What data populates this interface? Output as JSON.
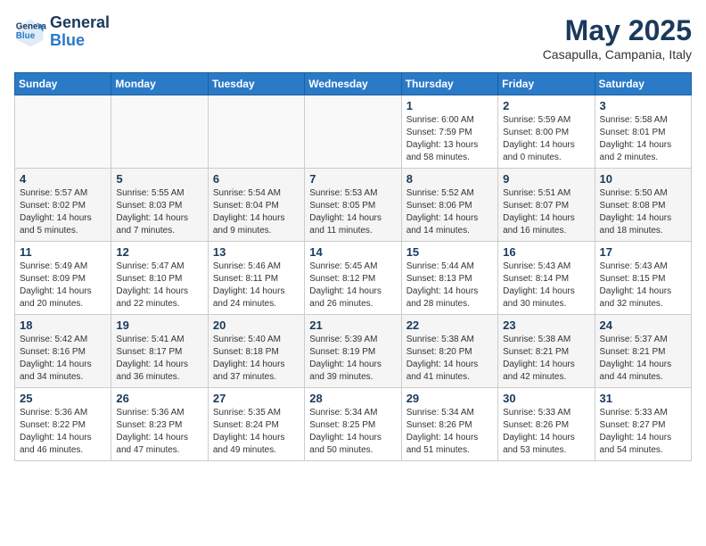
{
  "header": {
    "logo_line1": "General",
    "logo_line2": "Blue",
    "month": "May 2025",
    "location": "Casapulla, Campania, Italy"
  },
  "weekdays": [
    "Sunday",
    "Monday",
    "Tuesday",
    "Wednesday",
    "Thursday",
    "Friday",
    "Saturday"
  ],
  "weeks": [
    [
      {
        "day": "",
        "info": ""
      },
      {
        "day": "",
        "info": ""
      },
      {
        "day": "",
        "info": ""
      },
      {
        "day": "",
        "info": ""
      },
      {
        "day": "1",
        "info": "Sunrise: 6:00 AM\nSunset: 7:59 PM\nDaylight: 13 hours\nand 58 minutes."
      },
      {
        "day": "2",
        "info": "Sunrise: 5:59 AM\nSunset: 8:00 PM\nDaylight: 14 hours\nand 0 minutes."
      },
      {
        "day": "3",
        "info": "Sunrise: 5:58 AM\nSunset: 8:01 PM\nDaylight: 14 hours\nand 2 minutes."
      }
    ],
    [
      {
        "day": "4",
        "info": "Sunrise: 5:57 AM\nSunset: 8:02 PM\nDaylight: 14 hours\nand 5 minutes."
      },
      {
        "day": "5",
        "info": "Sunrise: 5:55 AM\nSunset: 8:03 PM\nDaylight: 14 hours\nand 7 minutes."
      },
      {
        "day": "6",
        "info": "Sunrise: 5:54 AM\nSunset: 8:04 PM\nDaylight: 14 hours\nand 9 minutes."
      },
      {
        "day": "7",
        "info": "Sunrise: 5:53 AM\nSunset: 8:05 PM\nDaylight: 14 hours\nand 11 minutes."
      },
      {
        "day": "8",
        "info": "Sunrise: 5:52 AM\nSunset: 8:06 PM\nDaylight: 14 hours\nand 14 minutes."
      },
      {
        "day": "9",
        "info": "Sunrise: 5:51 AM\nSunset: 8:07 PM\nDaylight: 14 hours\nand 16 minutes."
      },
      {
        "day": "10",
        "info": "Sunrise: 5:50 AM\nSunset: 8:08 PM\nDaylight: 14 hours\nand 18 minutes."
      }
    ],
    [
      {
        "day": "11",
        "info": "Sunrise: 5:49 AM\nSunset: 8:09 PM\nDaylight: 14 hours\nand 20 minutes."
      },
      {
        "day": "12",
        "info": "Sunrise: 5:47 AM\nSunset: 8:10 PM\nDaylight: 14 hours\nand 22 minutes."
      },
      {
        "day": "13",
        "info": "Sunrise: 5:46 AM\nSunset: 8:11 PM\nDaylight: 14 hours\nand 24 minutes."
      },
      {
        "day": "14",
        "info": "Sunrise: 5:45 AM\nSunset: 8:12 PM\nDaylight: 14 hours\nand 26 minutes."
      },
      {
        "day": "15",
        "info": "Sunrise: 5:44 AM\nSunset: 8:13 PM\nDaylight: 14 hours\nand 28 minutes."
      },
      {
        "day": "16",
        "info": "Sunrise: 5:43 AM\nSunset: 8:14 PM\nDaylight: 14 hours\nand 30 minutes."
      },
      {
        "day": "17",
        "info": "Sunrise: 5:43 AM\nSunset: 8:15 PM\nDaylight: 14 hours\nand 32 minutes."
      }
    ],
    [
      {
        "day": "18",
        "info": "Sunrise: 5:42 AM\nSunset: 8:16 PM\nDaylight: 14 hours\nand 34 minutes."
      },
      {
        "day": "19",
        "info": "Sunrise: 5:41 AM\nSunset: 8:17 PM\nDaylight: 14 hours\nand 36 minutes."
      },
      {
        "day": "20",
        "info": "Sunrise: 5:40 AM\nSunset: 8:18 PM\nDaylight: 14 hours\nand 37 minutes."
      },
      {
        "day": "21",
        "info": "Sunrise: 5:39 AM\nSunset: 8:19 PM\nDaylight: 14 hours\nand 39 minutes."
      },
      {
        "day": "22",
        "info": "Sunrise: 5:38 AM\nSunset: 8:20 PM\nDaylight: 14 hours\nand 41 minutes."
      },
      {
        "day": "23",
        "info": "Sunrise: 5:38 AM\nSunset: 8:21 PM\nDaylight: 14 hours\nand 42 minutes."
      },
      {
        "day": "24",
        "info": "Sunrise: 5:37 AM\nSunset: 8:21 PM\nDaylight: 14 hours\nand 44 minutes."
      }
    ],
    [
      {
        "day": "25",
        "info": "Sunrise: 5:36 AM\nSunset: 8:22 PM\nDaylight: 14 hours\nand 46 minutes."
      },
      {
        "day": "26",
        "info": "Sunrise: 5:36 AM\nSunset: 8:23 PM\nDaylight: 14 hours\nand 47 minutes."
      },
      {
        "day": "27",
        "info": "Sunrise: 5:35 AM\nSunset: 8:24 PM\nDaylight: 14 hours\nand 49 minutes."
      },
      {
        "day": "28",
        "info": "Sunrise: 5:34 AM\nSunset: 8:25 PM\nDaylight: 14 hours\nand 50 minutes."
      },
      {
        "day": "29",
        "info": "Sunrise: 5:34 AM\nSunset: 8:26 PM\nDaylight: 14 hours\nand 51 minutes."
      },
      {
        "day": "30",
        "info": "Sunrise: 5:33 AM\nSunset: 8:26 PM\nDaylight: 14 hours\nand 53 minutes."
      },
      {
        "day": "31",
        "info": "Sunrise: 5:33 AM\nSunset: 8:27 PM\nDaylight: 14 hours\nand 54 minutes."
      }
    ]
  ]
}
